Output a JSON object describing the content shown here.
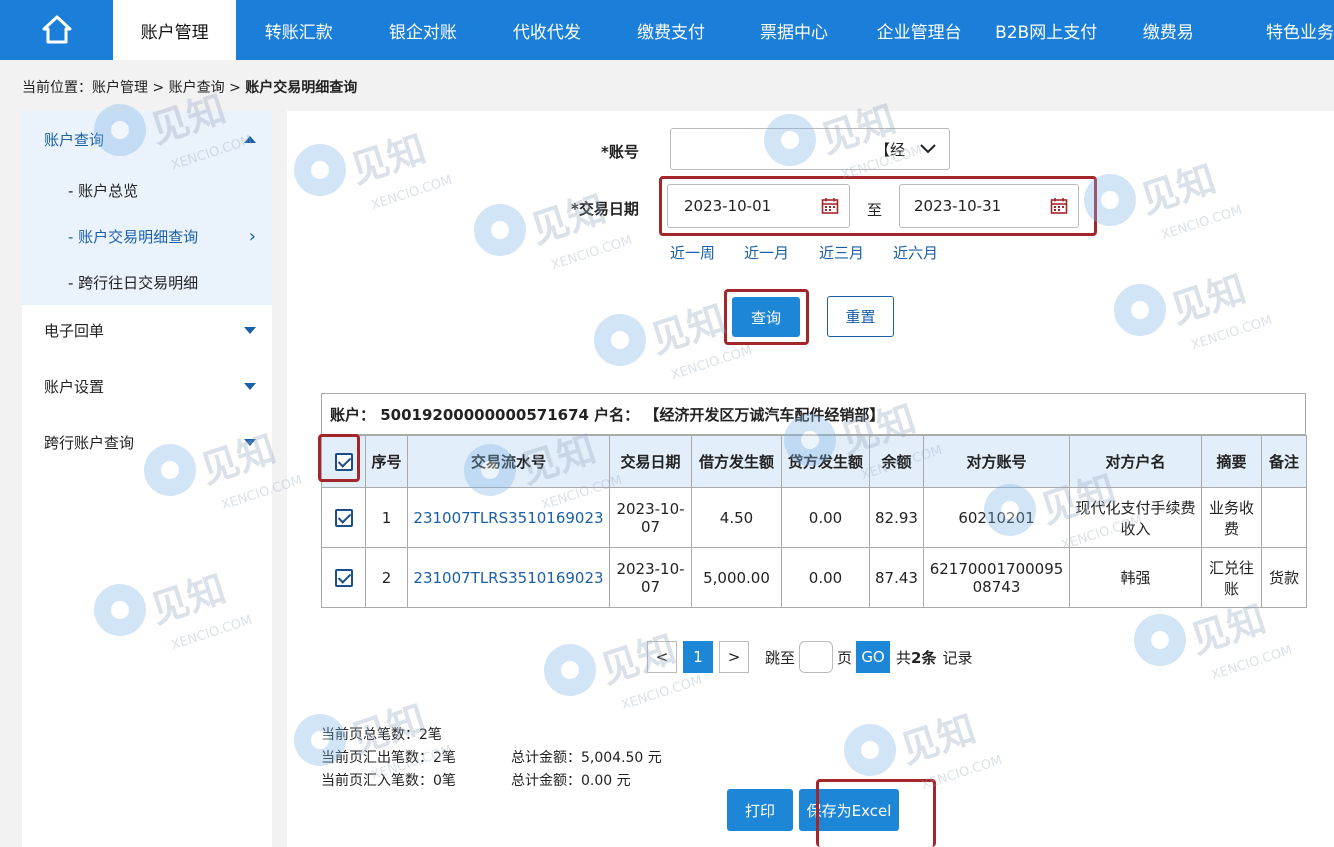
{
  "nav": {
    "home_icon": "home-icon",
    "items": [
      "账户管理",
      "转账汇款",
      "银企对账",
      "代收代发",
      "缴费支付",
      "票据中心",
      "企业管理台",
      "B2B网上支付",
      "缴费易",
      "特色业务"
    ]
  },
  "breadcrumb": {
    "prefix": "当前位置：",
    "path": "账户管理 > 账户查询 > ",
    "current": "账户交易明细查询"
  },
  "sidebar": {
    "groups": [
      "账户查询",
      "电子回单",
      "账户设置",
      "跨行账户查询"
    ],
    "sub_items": [
      "- 账户总览",
      "- 账户交易明细查询",
      "- 跨行往日交易明细"
    ]
  },
  "form": {
    "account_label": "*账号",
    "account_value": "【经",
    "date_label": "*交易日期",
    "date_start": "2023-10-01",
    "date_sep": "至",
    "date_end": "2023-10-31",
    "quick_ranges": [
      "近一周",
      "近一月",
      "近三月",
      "近六月"
    ],
    "query_button": "查询",
    "reset_button": "重置"
  },
  "account_bar": "账户： 50019200000000571674 户名： 【经济开发区万诚汽车配件经销部】",
  "table": {
    "headers": [
      "",
      "序号",
      "交易流水号",
      "交易日期",
      "借方发生额",
      "贷方发生额",
      "余额",
      "对方账号",
      "对方户名",
      "摘要",
      "备注"
    ],
    "rows": [
      [
        "",
        "1",
        "231007TLRS3510169023",
        "2023-10-07",
        "4.50",
        "0.00",
        "82.93",
        "60210201",
        "现代化支付手续费收入",
        "业务收费",
        ""
      ],
      [
        "",
        "2",
        "231007TLRS3510169023",
        "2023-10-07",
        "5,000.00",
        "0.00",
        "87.43",
        "6217000170009508743",
        "韩强",
        "汇兑往账",
        "货款"
      ]
    ]
  },
  "pager": {
    "prev": "<",
    "page": "1",
    "next": ">",
    "jump_label": "跳至",
    "page_unit": "页",
    "go": "GO",
    "total_prefix": "共",
    "total_count": "2条",
    "total_suffix": "记录"
  },
  "summary": {
    "page_total": "当前页总笔数：2笔",
    "page_out": "当前页汇出笔数：2笔",
    "page_out_amount": "总计金额：5,004.50 元",
    "page_in": "当前页汇入笔数：0笔",
    "page_in_amount": "总计金额：0.00 元"
  },
  "actions": {
    "print": "打印",
    "save_excel": "保存为Excel"
  },
  "colors": {
    "nav_bg": "#1b7fd9",
    "accent": "#1a5fa8",
    "highlight_frame": "#a3262b",
    "table_header_bg": "#e2effa"
  },
  "watermark": {
    "text": "见知",
    "sub": "XENCIO.COM"
  }
}
